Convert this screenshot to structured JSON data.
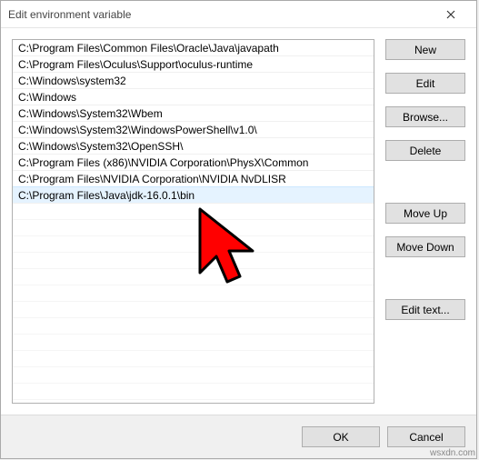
{
  "window": {
    "title": "Edit environment variable"
  },
  "list": {
    "items": [
      "C:\\Program Files\\Common Files\\Oracle\\Java\\javapath",
      "C:\\Program Files\\Oculus\\Support\\oculus-runtime",
      "C:\\Windows\\system32",
      "C:\\Windows",
      "C:\\Windows\\System32\\Wbem",
      "C:\\Windows\\System32\\WindowsPowerShell\\v1.0\\",
      "C:\\Windows\\System32\\OpenSSH\\",
      "C:\\Program Files (x86)\\NVIDIA Corporation\\PhysX\\Common",
      "C:\\Program Files\\NVIDIA Corporation\\NVIDIA NvDLISR",
      "C:\\Program Files\\Java\\jdk-16.0.1\\bin"
    ],
    "selected_index": 9
  },
  "buttons": {
    "new": "New",
    "edit": "Edit",
    "browse": "Browse...",
    "delete": "Delete",
    "move_up": "Move Up",
    "move_down": "Move Down",
    "edit_text": "Edit text...",
    "ok": "OK",
    "cancel": "Cancel"
  },
  "watermark": "wsxdn.com"
}
